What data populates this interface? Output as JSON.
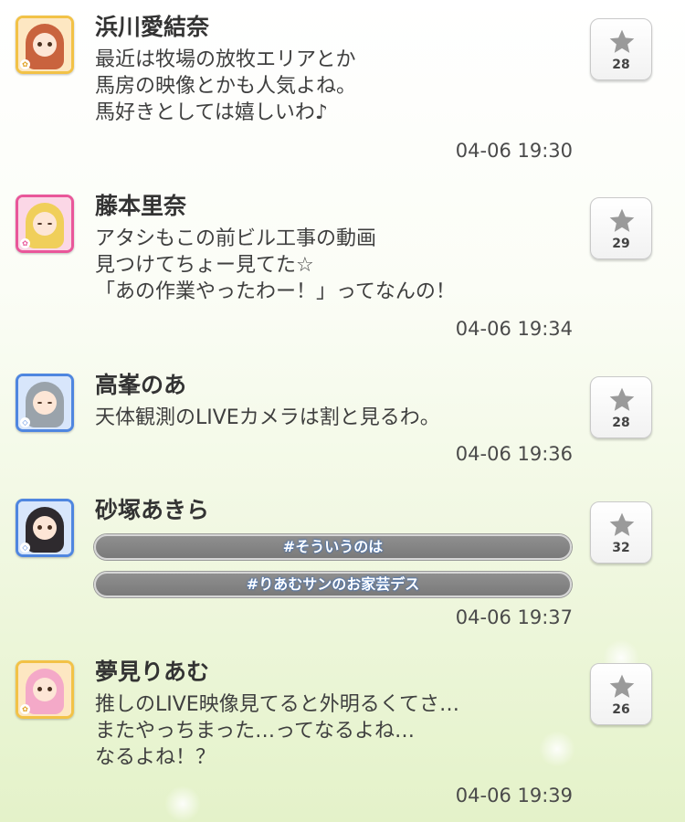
{
  "colors": {
    "name": "#333333",
    "message": "#3f3f3f",
    "hashtag_bg": "#858585",
    "star": "#9a9a9a",
    "background_bottom": "#e4f2c9"
  },
  "icons": {
    "like": "star-icon"
  },
  "posts": [
    {
      "author": "浜川愛結奈",
      "lines": [
        "最近は牧場の放牧エリアとか",
        "馬房の映像とかも人気よね。",
        "馬好きとしては嬉しいわ♪"
      ],
      "time": "04-06 19:30",
      "likes": "28",
      "avatar_color": "#f2c247",
      "badge": "✿"
    },
    {
      "author": "藤本里奈",
      "lines": [
        "アタシもこの前ビル工事の動画",
        "見つけてちょー見てた☆",
        "「あの作業やったわー！」ってなんの！"
      ],
      "time": "04-06 19:34",
      "likes": "29",
      "avatar_color": "#e9579a",
      "badge": "✿"
    },
    {
      "author": "高峯のあ",
      "lines": [
        "天体観測のLIVEカメラは割と見るわ。"
      ],
      "time": "04-06 19:36",
      "likes": "28",
      "avatar_color": "#4f86e0",
      "badge": "◇"
    },
    {
      "author": "砂塚あきら",
      "tags": [
        "#そういうのは",
        "#りあむサンのお家芸デス"
      ],
      "time": "04-06 19:37",
      "likes": "32",
      "avatar_color": "#4f86e0",
      "badge": "◇"
    },
    {
      "author": "夢見りあむ",
      "lines": [
        "推しのLIVE映像見てると外明るくてさ…",
        "またやっちまった…ってなるよね…",
        "なるよね！？"
      ],
      "time": "04-06 19:39",
      "likes": "26",
      "avatar_color": "#f2c247",
      "badge": "✿"
    }
  ]
}
